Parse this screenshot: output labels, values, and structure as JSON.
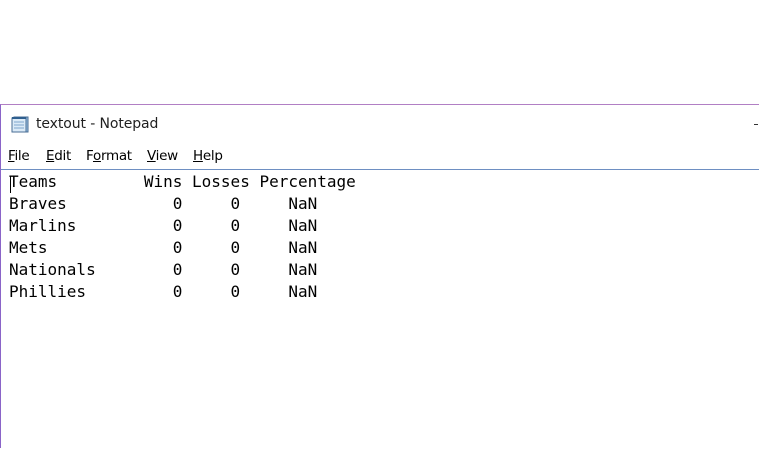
{
  "window": {
    "title": "textout - Notepad",
    "app_icon": "notepad-icon"
  },
  "menu": {
    "file": {
      "accel": "F",
      "rest": "ile"
    },
    "edit": {
      "accel": "E",
      "rest": "dit"
    },
    "format": {
      "pre": "F",
      "accel": "o",
      "rest": "rmat"
    },
    "view": {
      "accel": "V",
      "rest": "iew"
    },
    "help": {
      "accel": "H",
      "rest": "elp"
    }
  },
  "document": {
    "content": "Teams         Wins Losses Percentage\nBraves           0     0     NaN\nMarlins          0     0     NaN\nMets             0     0     NaN\nNationals        0     0     NaN\nPhillies         0     0     NaN"
  },
  "colors": {
    "window_border_top": "#b17fc4",
    "window_border_left": "#8a64c8",
    "editor_border": "#6e8fc2"
  }
}
